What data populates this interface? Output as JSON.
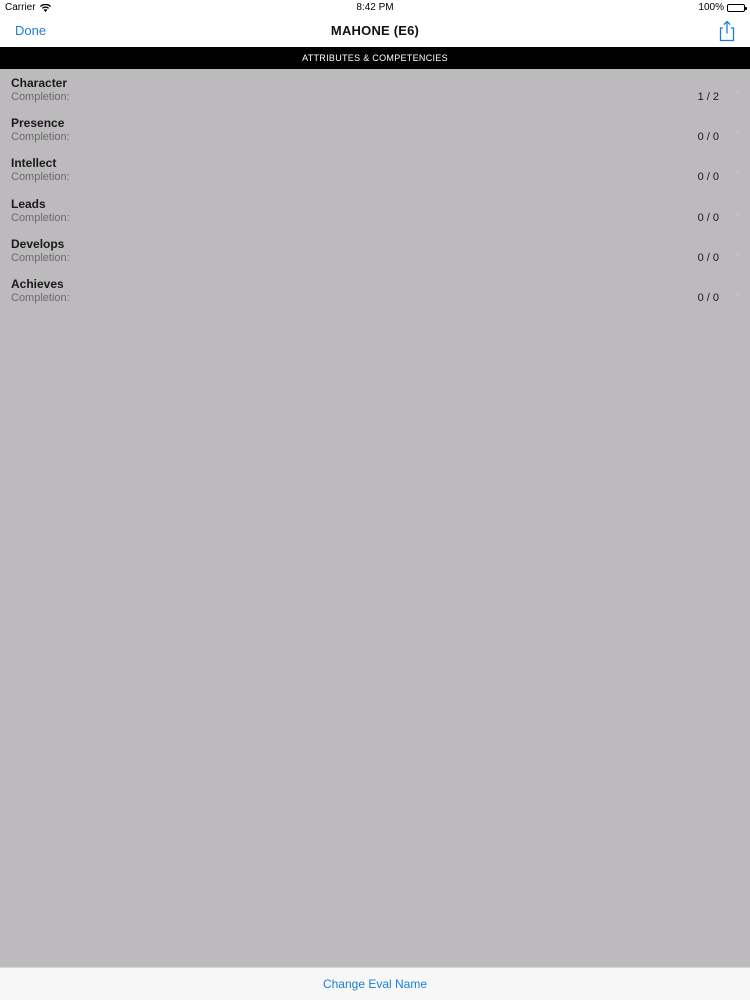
{
  "status_bar": {
    "carrier": "Carrier",
    "time": "8:42 PM",
    "battery": "100%"
  },
  "nav": {
    "done_label": "Done",
    "title": "MAHONE (E6)"
  },
  "section_header": "ATTRIBUTES & COMPETENCIES",
  "rows": [
    {
      "name": "Character",
      "label": "Completion:",
      "count": "1 / 2"
    },
    {
      "name": "Presence",
      "label": "Completion:",
      "count": "0 / 0"
    },
    {
      "name": "Intellect",
      "label": "Completion:",
      "count": "0 / 0"
    },
    {
      "name": "Leads",
      "label": "Completion:",
      "count": "0 / 0"
    },
    {
      "name": "Develops",
      "label": "Completion:",
      "count": "0 / 0"
    },
    {
      "name": "Achieves",
      "label": "Completion:",
      "count": "0 / 0"
    }
  ],
  "bottom": {
    "change_name_label": "Change Eval Name"
  },
  "colors": {
    "accent": "#1b7fd6",
    "background": "#bcbabc",
    "header": "#000000"
  },
  "icons": {
    "wifi": "wifi-icon",
    "battery": "battery-icon",
    "share": "share-icon",
    "chevron": "chevron-right-icon"
  }
}
